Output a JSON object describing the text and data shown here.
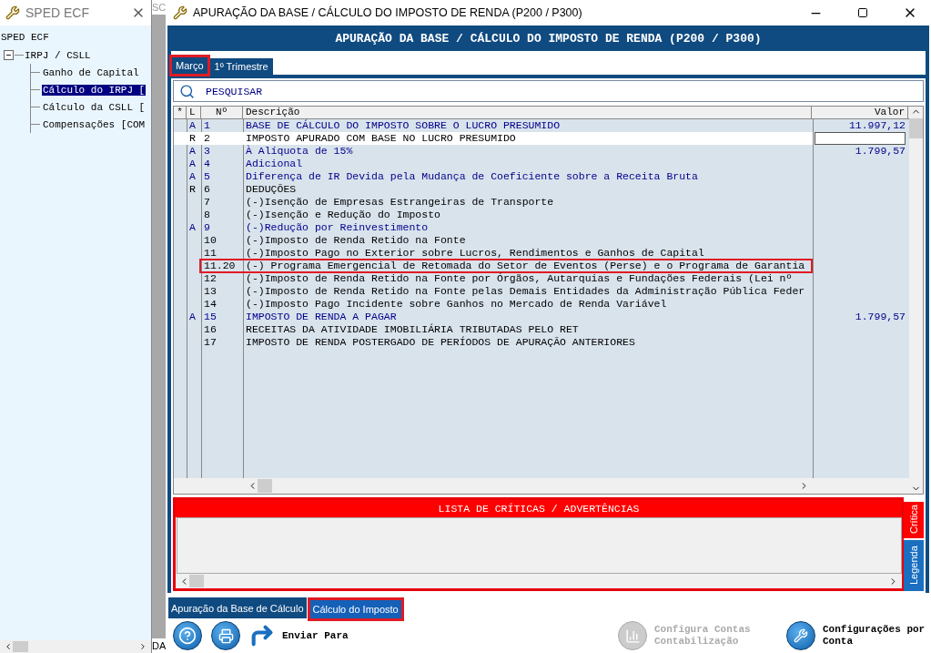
{
  "side_window": {
    "title": "SPED ECF",
    "tree": [
      {
        "label": "SPED ECF",
        "children": [
          {
            "label": "IRPJ / CSLL",
            "expanded": true,
            "children": [
              {
                "label": "Ganho de Capital",
                "selected": false
              },
              {
                "label": "Cálculo do IRPJ [",
                "selected": true
              },
              {
                "label": "Cálculo da CSLL [",
                "selected": false
              },
              {
                "label": "Compensações [COM",
                "selected": false
              }
            ]
          }
        ]
      }
    ]
  },
  "behind_window": {
    "top_text": "SC",
    "bottom_text": "DA"
  },
  "window": {
    "title": "APURAÇÃO DA BASE / CÁLCULO DO IMPOSTO DE RENDA (P200 / P300)",
    "header": "APURAÇÃO DA BASE / CÁLCULO DO IMPOSTO DE RENDA (P200 / P300)"
  },
  "period_tabs": [
    {
      "label": "Março",
      "selected": true
    },
    {
      "label": "1º Trimestre",
      "selected": false
    }
  ],
  "search": {
    "placeholder": "PESQUISAR"
  },
  "table": {
    "columns": [
      "*",
      "L",
      "Nº",
      "Descrição",
      "Valor"
    ],
    "rows": [
      {
        "l": "A",
        "n": "1",
        "desc": "BASE DE CÁLCULO DO IMPOSTO SOBRE O LUCRO PRESUMIDO",
        "value": "11.997,12",
        "kind": "calculated",
        "selected": false,
        "highlighted": false
      },
      {
        "l": "R",
        "n": "2",
        "desc": "IMPOSTO APURADO COM BASE NO LUCRO PRESUMIDO",
        "kind": "plain",
        "selected": true,
        "highlighted": false
      },
      {
        "l": "A",
        "n": "3",
        "desc": "À Alíquota de 15%",
        "value": "1.799,57",
        "kind": "calculated",
        "selected": false,
        "highlighted": false
      },
      {
        "l": "A",
        "n": "4",
        "desc": "Adicional",
        "kind": "calculated",
        "selected": false,
        "highlighted": false
      },
      {
        "l": "A",
        "n": "5",
        "desc": "Diferença de IR Devida pela Mudança de Coeficiente sobre a Receita Bruta",
        "kind": "calculated",
        "selected": false,
        "highlighted": false
      },
      {
        "l": "R",
        "n": "6",
        "desc": "DEDUÇÕES",
        "kind": "plain",
        "selected": false,
        "highlighted": false
      },
      {
        "n": "7",
        "desc": "(-)Isenção de Empresas Estrangeiras de Transporte",
        "kind": "plain",
        "selected": false,
        "highlighted": false
      },
      {
        "n": "8",
        "desc": "(-)Isenção e Redução do Imposto",
        "kind": "plain",
        "selected": false,
        "highlighted": false
      },
      {
        "l": "A",
        "n": "9",
        "desc": "(-)Redução por Reinvestimento",
        "kind": "calculated",
        "selected": false,
        "highlighted": false
      },
      {
        "n": "10",
        "desc": "(-)Imposto de Renda Retido na Fonte",
        "kind": "plain",
        "selected": false,
        "highlighted": false
      },
      {
        "n": "11",
        "desc": "(-)Imposto Pago no Exterior sobre Lucros, Rendimentos e Ganhos de Capital",
        "kind": "plain",
        "selected": false,
        "highlighted": false
      },
      {
        "n": "11.20",
        "desc": "(-) Programa Emergencial de Retomada do Setor de Eventos (Perse) e o Programa de Garantia",
        "kind": "plain",
        "selected": false,
        "highlighted": true
      },
      {
        "n": "12",
        "desc": "(-)Imposto de Renda Retido na Fonte por Órgãos, Autarquias e Fundações Federais (Lei nº",
        "kind": "plain",
        "selected": false,
        "highlighted": false
      },
      {
        "n": "13",
        "desc": "(-)Imposto de Renda Retido na Fonte pelas Demais Entidades da Administração Pública Feder",
        "kind": "plain",
        "selected": false,
        "highlighted": false
      },
      {
        "n": "14",
        "desc": "(-)Imposto Pago Incidente sobre Ganhos no Mercado de Renda Variável",
        "kind": "plain",
        "selected": false,
        "highlighted": false
      },
      {
        "l": "A",
        "n": "15",
        "desc": "IMPOSTO DE RENDA A PAGAR",
        "value": "1.799,57",
        "kind": "calculated",
        "selected": false,
        "highlighted": false
      },
      {
        "n": "16",
        "desc": "RECEITAS DA ATIVIDADE IMOBILIÁRIA TRIBUTADAS PELO RET",
        "kind": "plain",
        "selected": false,
        "highlighted": false
      },
      {
        "n": "17",
        "desc": "IMPOSTO DE RENDA POSTERGADO DE PERÍODOS DE APURAÇÃO ANTERIORES",
        "kind": "plain",
        "selected": false,
        "highlighted": false
      }
    ]
  },
  "critics": {
    "title": "LISTA DE CRÍTICAS / ADVERTÊNCIAS",
    "side_tabs": [
      {
        "label": "Crítica",
        "selected": true
      },
      {
        "label": "Legenda",
        "selected": false
      }
    ]
  },
  "bottom_tabs": [
    {
      "label": "Apuração da Base de Cálculo",
      "selected": false
    },
    {
      "label": "Cálculo do Imposto",
      "selected": true
    }
  ],
  "toolbar": [
    {
      "kind": "help",
      "disabled": false
    },
    {
      "kind": "print",
      "disabled": false
    },
    {
      "kind": "send",
      "label": "Enviar Para",
      "disabled": false
    },
    {
      "kind": "accounts",
      "label": "Configura Contas Contabilização",
      "disabled": true
    },
    {
      "kind": "settings",
      "label": "Configurações por Conta",
      "disabled": false
    }
  ]
}
